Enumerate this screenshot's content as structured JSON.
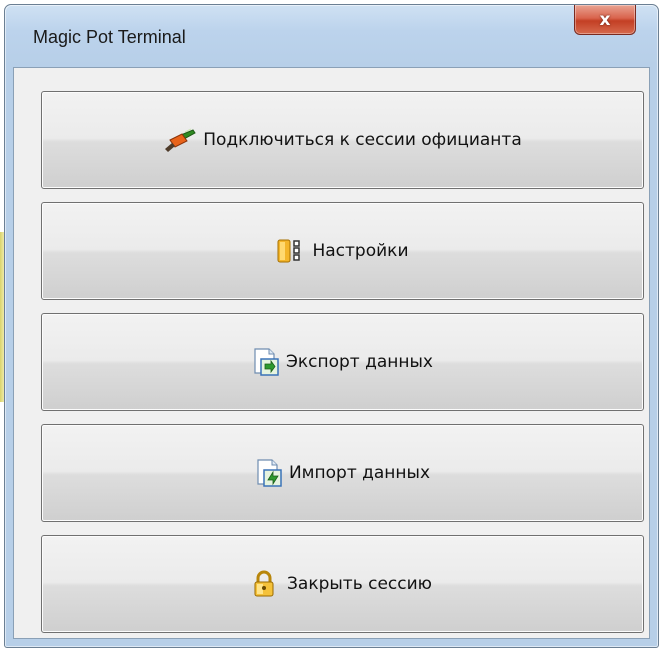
{
  "window": {
    "title": "Magic Pot Terminal"
  },
  "titlebar": {
    "close_glyph": "x"
  },
  "menu": {
    "buttons": [
      {
        "label": "Подключиться к сессии официанта",
        "icon": "plug-icon"
      },
      {
        "label": "Настройки",
        "icon": "settings-icon"
      },
      {
        "label": "Экспорт данных",
        "icon": "export-icon"
      },
      {
        "label": "Импорт данных",
        "icon": "import-icon"
      },
      {
        "label": "Закрыть сессию",
        "icon": "lock-icon"
      }
    ]
  },
  "colors": {
    "title_bar": "#bcd3ec",
    "close_button": "#c8452b",
    "button_face": "#e6e6e6",
    "client_bg": "#f0f0f0"
  }
}
